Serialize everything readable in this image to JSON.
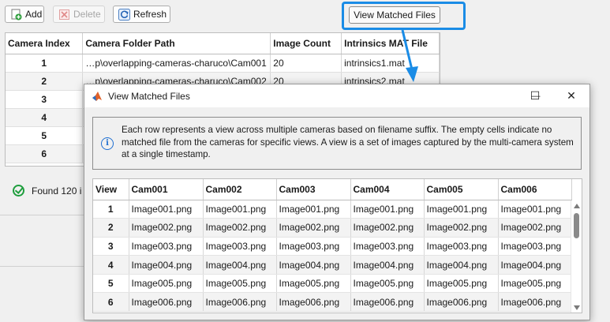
{
  "toolbar": {
    "add_label": "Add",
    "delete_label": "Delete",
    "refresh_label": "Refresh",
    "view_matched_label": "View Matched Files"
  },
  "camera_table": {
    "columns": [
      "Camera Index",
      "Camera Folder Path",
      "Image Count",
      "Intrinsics MAT File"
    ],
    "rows": [
      {
        "index": "1",
        "path": "…p\\overlapping-cameras-charuco\\Cam001",
        "count": "20",
        "mat": "intrinsics1.mat"
      },
      {
        "index": "2",
        "path": "…p\\overlapping-cameras-charuco\\Cam002",
        "count": "20",
        "mat": "intrinsics2.mat"
      },
      {
        "index": "3",
        "path": "",
        "count": "",
        "mat": ""
      },
      {
        "index": "4",
        "path": "",
        "count": "",
        "mat": ""
      },
      {
        "index": "5",
        "path": "",
        "count": "",
        "mat": ""
      },
      {
        "index": "6",
        "path": "",
        "count": "",
        "mat": ""
      }
    ]
  },
  "status": {
    "text": "Found 120 i"
  },
  "dialog": {
    "title": "View Matched Files",
    "minimize": "—",
    "maximize": "☐",
    "close": "✕",
    "info_text": "Each row represents a view across multiple cameras based on filename suffix. The empty cells indicate no matched file from the cameras for specific views. A view is a set of images captured by the multi-camera system at a single timestamp.",
    "columns": [
      "View",
      "Cam001",
      "Cam002",
      "Cam003",
      "Cam004",
      "Cam005",
      "Cam006"
    ],
    "rows": [
      {
        "view": "1",
        "files": [
          "Image001.png",
          "Image001.png",
          "Image001.png",
          "Image001.png",
          "Image001.png",
          "Image001.png"
        ]
      },
      {
        "view": "2",
        "files": [
          "Image002.png",
          "Image002.png",
          "Image002.png",
          "Image002.png",
          "Image002.png",
          "Image002.png"
        ]
      },
      {
        "view": "3",
        "files": [
          "Image003.png",
          "Image003.png",
          "Image003.png",
          "Image003.png",
          "Image003.png",
          "Image003.png"
        ]
      },
      {
        "view": "4",
        "files": [
          "Image004.png",
          "Image004.png",
          "Image004.png",
          "Image004.png",
          "Image004.png",
          "Image004.png"
        ]
      },
      {
        "view": "5",
        "files": [
          "Image005.png",
          "Image005.png",
          "Image005.png",
          "Image005.png",
          "Image005.png",
          "Image005.png"
        ]
      },
      {
        "view": "6",
        "files": [
          "Image006.png",
          "Image006.png",
          "Image006.png",
          "Image006.png",
          "Image006.png",
          "Image006.png"
        ]
      }
    ]
  },
  "colors": {
    "highlight": "#1a8ce6",
    "success": "#1f9e3e",
    "info": "#1f6fd1"
  }
}
